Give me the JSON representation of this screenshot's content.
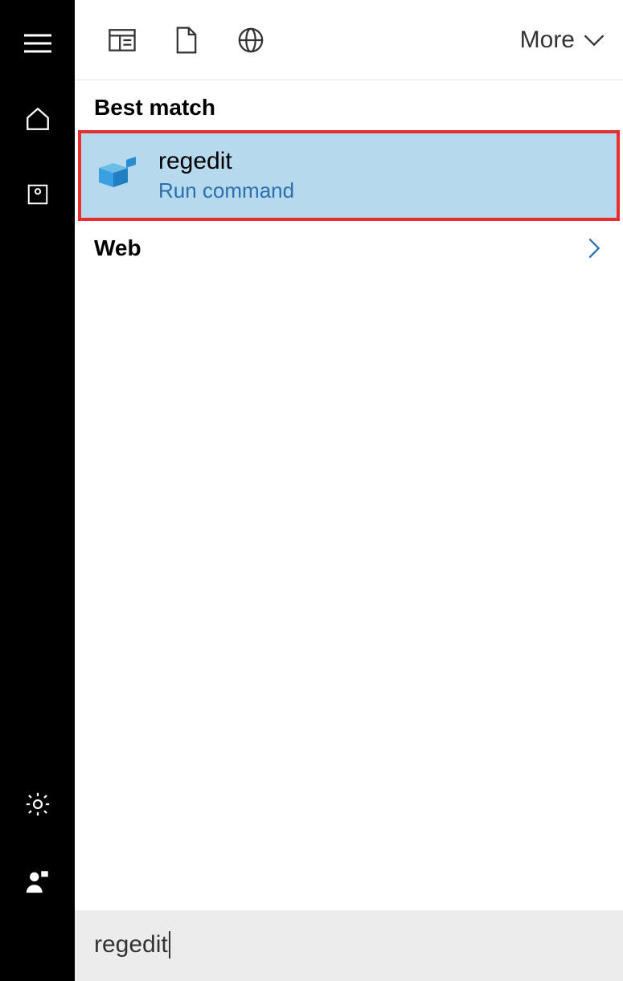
{
  "filterBar": {
    "more": "More"
  },
  "sections": {
    "bestMatch": "Best match",
    "web": "Web"
  },
  "bestMatchResult": {
    "title": "regedit",
    "subtitle": "Run command"
  },
  "search": {
    "value": "regedit"
  }
}
